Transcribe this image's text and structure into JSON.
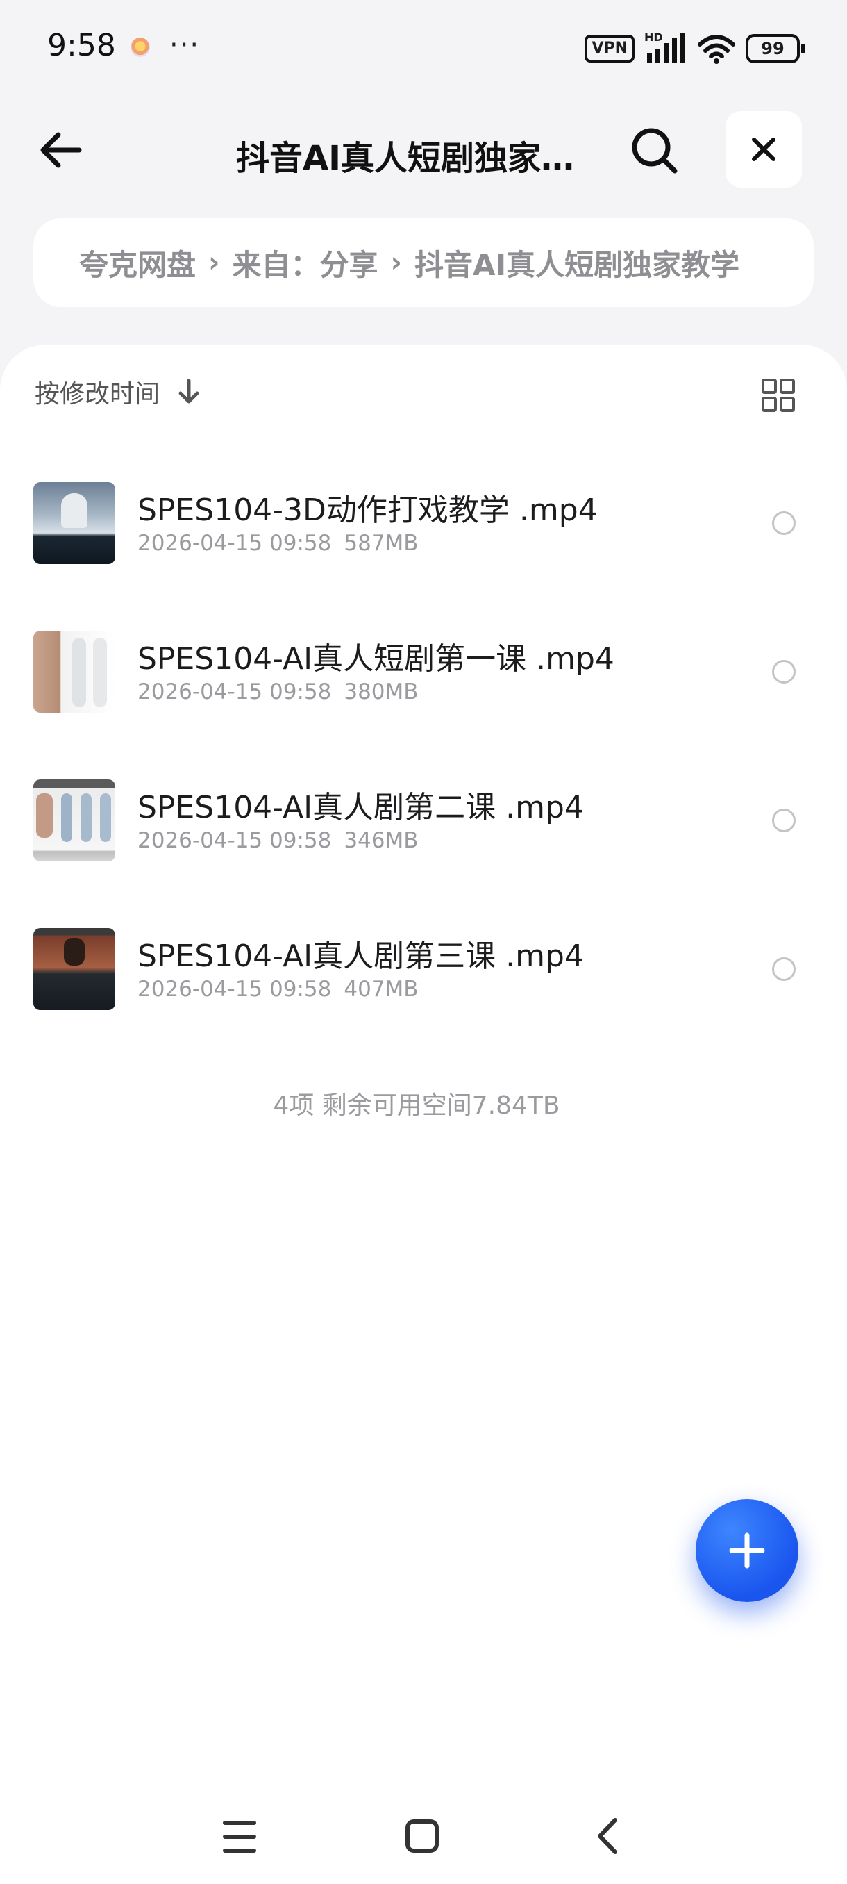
{
  "status_bar": {
    "time": "9:58",
    "dots": "···",
    "vpn": "VPN",
    "network": "HD",
    "battery": "99",
    "icons": [
      "app-notification-icon",
      "signal-icon",
      "wifi-icon",
      "battery-icon"
    ]
  },
  "header": {
    "title": "抖音AI真人短剧独家教学",
    "icons": [
      "back-arrow-icon",
      "search-icon",
      "close-icon"
    ]
  },
  "breadcrumb": {
    "items": [
      "夸克网盘",
      "来自：分享",
      "抖音AI真人短剧独家教学"
    ]
  },
  "toolbar": {
    "sort_label": "按修改时间",
    "icons": [
      "sort-down-arrow-icon",
      "grid-view-icon"
    ]
  },
  "files": [
    {
      "name": "SPES104-3D动作打戏教学 .mp4",
      "date": "2026-04-15 09:58",
      "size": "587MB"
    },
    {
      "name": "SPES104-AI真人短剧第一课 .mp4",
      "date": "2026-04-15 09:58",
      "size": "380MB"
    },
    {
      "name": "SPES104-AI真人剧第二课 .mp4",
      "date": "2026-04-15 09:58",
      "size": "346MB"
    },
    {
      "name": "SPES104-AI真人剧第三课 .mp4",
      "date": "2026-04-15 09:58",
      "size": "407MB"
    }
  ],
  "summary": "4项 剩余可用空间7.84TB",
  "fab_icon": "plus-icon",
  "nav": [
    "menu-icon",
    "home-icon",
    "back-icon"
  ],
  "colors": {
    "accent": "#1a55ee",
    "background": "#f4f4f6",
    "text_secondary": "#9a9a9f"
  }
}
